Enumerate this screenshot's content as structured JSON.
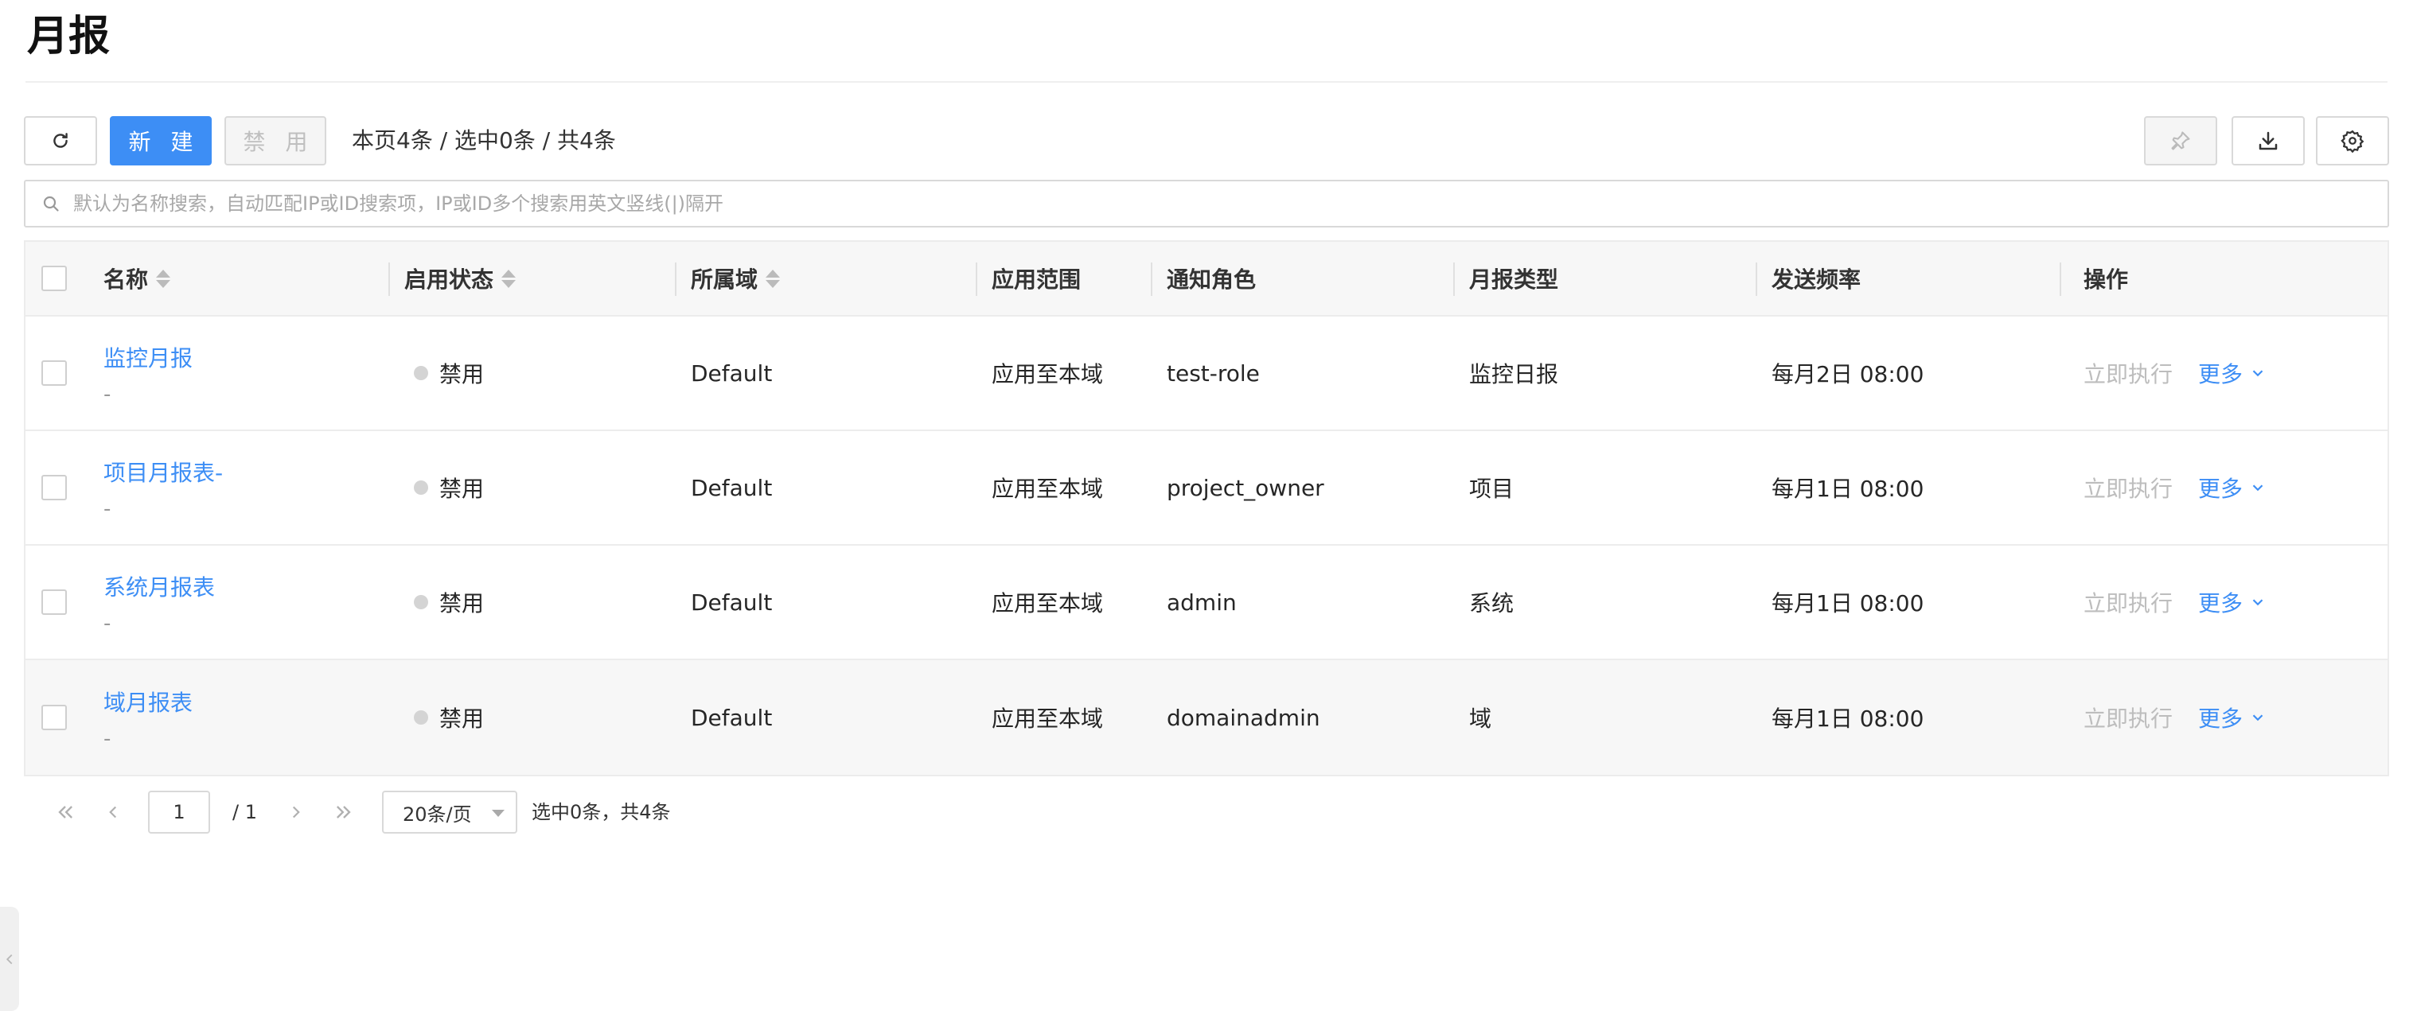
{
  "page": {
    "title": "月报"
  },
  "toolbar": {
    "new_label": "新 建",
    "disable_label": "禁 用",
    "count_text": "本页4条 / 选中0条 / 共4条"
  },
  "search": {
    "placeholder": "默认为名称搜索，自动匹配IP或ID搜索项，IP或ID多个搜索用英文竖线(|)隔开"
  },
  "table": {
    "columns": [
      "名称",
      "启用状态",
      "所属域",
      "应用范围",
      "通知角色",
      "月报类型",
      "发送频率",
      "操作"
    ],
    "rows": [
      {
        "name": "监控月报",
        "desc": "-",
        "status": "禁用",
        "domain": "Default",
        "scope": "应用至本域",
        "role": "test-role",
        "type": "监控日报",
        "frequency": "每月2日 08:00",
        "action_run": "立即执行",
        "action_more": "更多"
      },
      {
        "name": "项目月报表-",
        "desc": "-",
        "status": "禁用",
        "domain": "Default",
        "scope": "应用至本域",
        "role": "project_owner",
        "type": "项目",
        "frequency": "每月1日 08:00",
        "action_run": "立即执行",
        "action_more": "更多"
      },
      {
        "name": "系统月报表",
        "desc": "-",
        "status": "禁用",
        "domain": "Default",
        "scope": "应用至本域",
        "role": "admin",
        "type": "系统",
        "frequency": "每月1日 08:00",
        "action_run": "立即执行",
        "action_more": "更多"
      },
      {
        "name": "域月报表",
        "desc": "-",
        "status": "禁用",
        "domain": "Default",
        "scope": "应用至本域",
        "role": "domainadmin",
        "type": "域",
        "frequency": "每月1日 08:00",
        "action_run": "立即执行",
        "action_more": "更多"
      }
    ]
  },
  "pagination": {
    "current_page": "1",
    "total_pages": "/ 1",
    "page_size": "20条/页",
    "info": "选中0条，共4条"
  },
  "colors": {
    "primary": "#3d8ef5",
    "status_disabled": "#d4d4d4",
    "muted_text": "#bdbdbd"
  },
  "icons": [
    "refresh-icon",
    "pin-icon",
    "download-icon",
    "settings-icon",
    "search-icon",
    "sort-icon",
    "chevron-down-icon",
    "first-page-icon",
    "prev-page-icon",
    "next-page-icon",
    "last-page-icon",
    "collapse-left-icon"
  ]
}
